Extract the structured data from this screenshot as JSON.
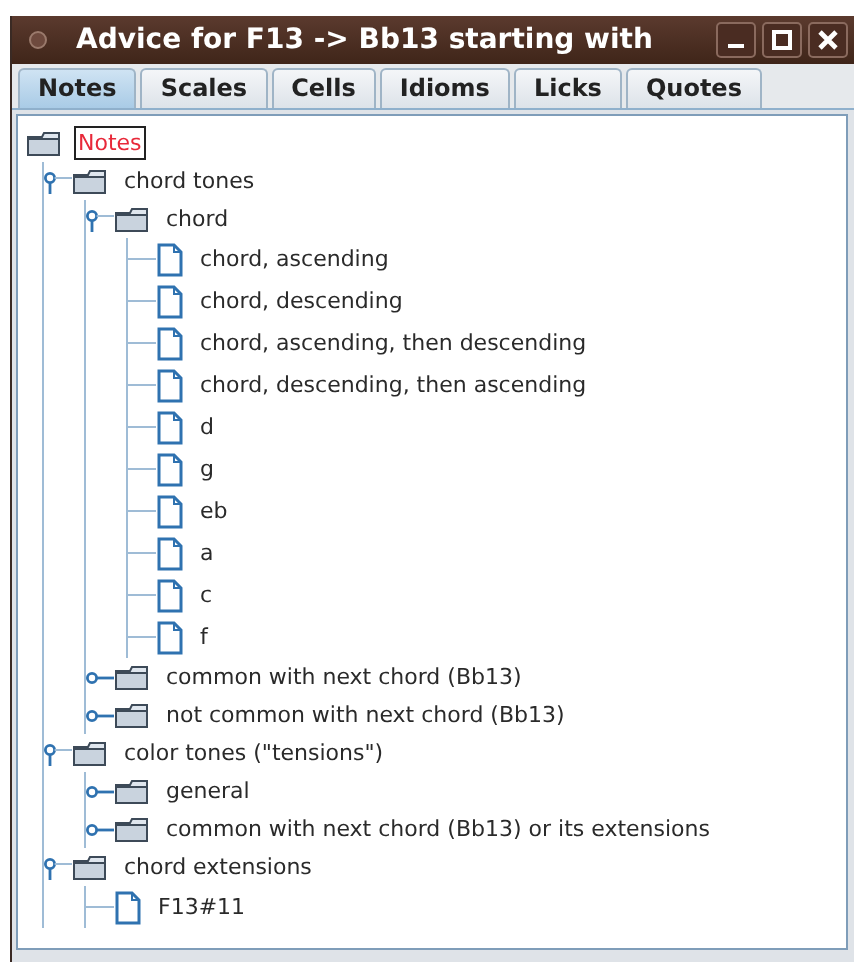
{
  "window": {
    "title": "Advice for F13 -> Bb13 starting with"
  },
  "tabs": [
    {
      "label": "Notes",
      "selected": true
    },
    {
      "label": "Scales",
      "selected": false
    },
    {
      "label": "Cells",
      "selected": false
    },
    {
      "label": "Idioms",
      "selected": false
    },
    {
      "label": "Licks",
      "selected": false
    },
    {
      "label": "Quotes",
      "selected": false
    }
  ],
  "tree": {
    "label": "Notes",
    "kind": "folder",
    "selected": true,
    "children": [
      {
        "label": "chord tones",
        "kind": "folder",
        "selected": false,
        "expanded": true,
        "children": [
          {
            "label": "chord",
            "kind": "folder",
            "selected": false,
            "expanded": true,
            "children": [
              {
                "label": "chord, ascending",
                "kind": "leaf",
                "selected": false
              },
              {
                "label": "chord, descending",
                "kind": "leaf",
                "selected": false
              },
              {
                "label": "chord, ascending, then descending",
                "kind": "leaf",
                "selected": false
              },
              {
                "label": "chord, descending, then ascending",
                "kind": "leaf",
                "selected": false
              },
              {
                "label": "d",
                "kind": "leaf",
                "selected": false
              },
              {
                "label": "g",
                "kind": "leaf",
                "selected": false
              },
              {
                "label": "eb",
                "kind": "leaf",
                "selected": false
              },
              {
                "label": "a",
                "kind": "leaf",
                "selected": false
              },
              {
                "label": "c",
                "kind": "leaf",
                "selected": false
              },
              {
                "label": "f",
                "kind": "leaf",
                "selected": false
              }
            ]
          },
          {
            "label": "common with next chord (Bb13)",
            "kind": "folder",
            "selected": false,
            "expanded": false
          },
          {
            "label": "not common with next chord (Bb13)",
            "kind": "folder",
            "selected": false,
            "expanded": false
          }
        ]
      },
      {
        "label": "color tones (\"tensions\")",
        "kind": "folder",
        "selected": false,
        "expanded": true,
        "children": [
          {
            "label": "general",
            "kind": "folder",
            "selected": false,
            "expanded": false
          },
          {
            "label": "common with next chord (Bb13) or its extensions",
            "kind": "folder",
            "selected": false,
            "expanded": false
          }
        ]
      },
      {
        "label": "chord extensions",
        "kind": "folder",
        "selected": false,
        "expanded": true,
        "children": [
          {
            "label": "F13#11",
            "kind": "leaf",
            "selected": false
          }
        ]
      }
    ]
  }
}
